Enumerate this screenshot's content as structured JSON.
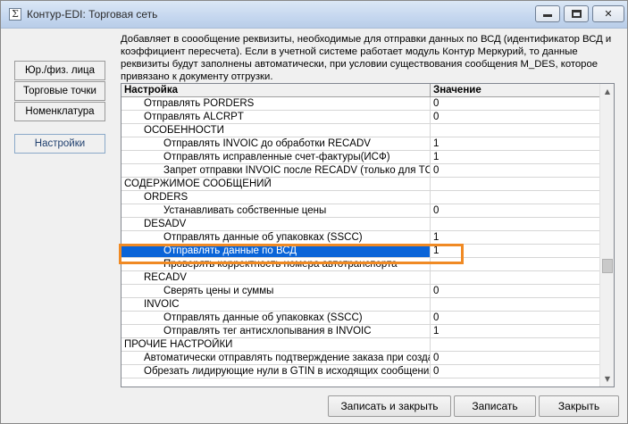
{
  "window": {
    "title": "Контур-EDI: Торговая сеть",
    "app_icon": "Σ"
  },
  "description": "Добавляет в соообщение реквизиты, необходимые для отправки данных по ВСД (идентификатор ВСД и коэффициент пересчета). Если в учетной системе работает модуль Контур Меркурий, то данные реквизиты будут заполнены автоматически, при условии существования сообщения M_DES, которое привязано к документу отгрузки.",
  "nav": {
    "legal": "Юр./физ. лица",
    "outlets": "Торговые точки",
    "nomenclature": "Номенклатура",
    "settings": "Настройки"
  },
  "grid": {
    "col_setting": "Настройка",
    "col_value": "Значение",
    "rows": [
      {
        "label": "Отправлять PORDERS",
        "value": "0"
      },
      {
        "label": "Отправлять ALCRPT",
        "value": "0"
      },
      {
        "label": "ОСОБЕННОСТИ",
        "value": ""
      },
      {
        "label": "Отправлять INVOIC до обработки RECADV",
        "value": "1"
      },
      {
        "label": "Отправлять исправленные счет-фактуры(ИСФ)",
        "value": "1"
      },
      {
        "label": "Запрет отправки INVOIC после RECADV (только для ТС \"К",
        "value": "0"
      },
      {
        "label": "СОДЕРЖИМОЕ СООБЩЕНИЙ",
        "value": ""
      },
      {
        "label": "ORDERS",
        "value": ""
      },
      {
        "label": "Устанавливать собственные цены",
        "value": "0"
      },
      {
        "label": "DESADV",
        "value": ""
      },
      {
        "label": "Отправлять данные об упаковках (SSCC)",
        "value": "1"
      },
      {
        "label": "Отправлять данные по ВСД",
        "value": "1"
      },
      {
        "label": "Проверять корректность номера автотранспорта",
        "value": ""
      },
      {
        "label": "RECADV",
        "value": ""
      },
      {
        "label": "Сверять цены и суммы",
        "value": "0"
      },
      {
        "label": "INVOIC",
        "value": ""
      },
      {
        "label": "Отправлять данные об упаковках (SSCC)",
        "value": "0"
      },
      {
        "label": "Отправлять тег антисхлопывания в INVOIC",
        "value": "1"
      },
      {
        "label": "ПРОЧИЕ НАСТРОЙКИ",
        "value": ""
      },
      {
        "label": "Автоматически отправлять подтверждение заказа при создан",
        "value": "0"
      },
      {
        "label": "Обрезать лидирующие нули в GTIN в исходящих сообщениях",
        "value": "0"
      }
    ]
  },
  "buttons": {
    "save_close": "Записать и закрыть",
    "save": "Записать",
    "close": "Закрыть"
  },
  "colors": {
    "selection": "#0a64d8",
    "highlight": "#f08a24"
  },
  "scroll_position": 0.62
}
